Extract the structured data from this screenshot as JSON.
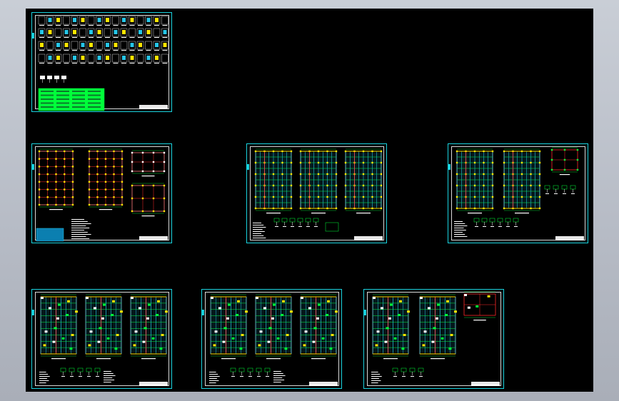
{
  "app": {
    "view": "CAD model space",
    "background": "#000000"
  },
  "colors": {
    "frame": "#19d3df",
    "line": "#d9d9d9",
    "green": "#00ff3a",
    "yellow": "#ffe600",
    "red": "#ff2a2a",
    "cyan": "#26c6e8",
    "white": "#ffffff"
  },
  "sheets": [
    {
      "id": "index-sheet",
      "kind": "index"
    },
    {
      "id": "foundation-sheet",
      "kind": "foundation"
    },
    {
      "id": "column-sheet-a",
      "kind": "column"
    },
    {
      "id": "column-sheet-b",
      "kind": "column-detail"
    },
    {
      "id": "beam-sheet-a",
      "kind": "beam"
    },
    {
      "id": "beam-sheet-b",
      "kind": "beam"
    },
    {
      "id": "beam-sheet-c",
      "kind": "beam-detail"
    }
  ]
}
